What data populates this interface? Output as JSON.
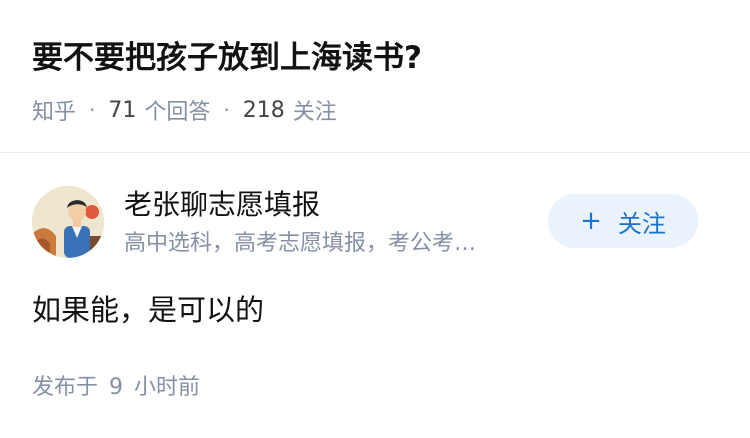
{
  "question": {
    "title": "要不要把孩子放到上海读书?",
    "source": "知乎",
    "answer_count": "71",
    "answer_label": "个回答",
    "follower_count": "218",
    "follower_label": "关注"
  },
  "author": {
    "avatar_icon": "author-avatar",
    "name": "老张聊志愿填报",
    "bio": "高中选科，高考志愿填报，考公考…",
    "follow_label": "关注",
    "follow_icon": "plus-icon"
  },
  "answer": {
    "text": "如果能，是可以的",
    "publish_prefix": "发布于",
    "publish_num": "9",
    "publish_suffix": "小时前"
  },
  "colors": {
    "accent": "#1772d0",
    "accent_bg": "#eaf2fb",
    "muted": "#8590a6",
    "text": "#121212"
  }
}
